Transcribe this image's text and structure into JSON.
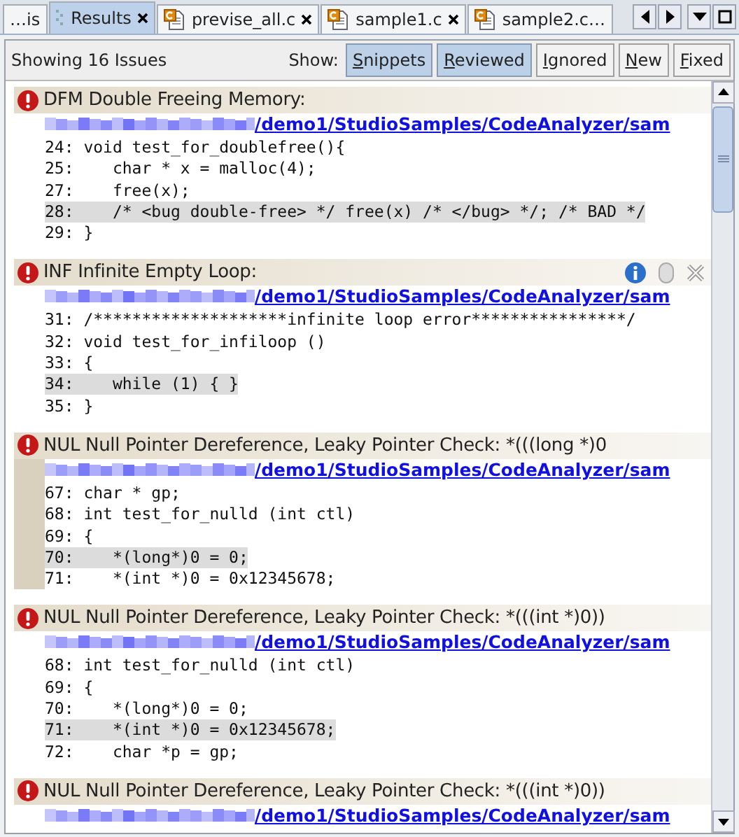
{
  "tabs": [
    {
      "label": "…is",
      "kind": "view",
      "selected": false,
      "closable": false
    },
    {
      "label": "Results",
      "kind": "view",
      "selected": true,
      "closable": true
    },
    {
      "label": "previse_all.c",
      "kind": "file",
      "selected": false,
      "closable": true
    },
    {
      "label": "sample1.c",
      "kind": "file",
      "selected": false,
      "closable": true
    },
    {
      "label": "sample2.c…",
      "kind": "file",
      "selected": false,
      "closable": false
    }
  ],
  "toolbar": {
    "summary": "Showing 16 Issues",
    "show_label": "Show:",
    "filters": [
      {
        "label": "Snippets",
        "selected": true
      },
      {
        "label": "Reviewed",
        "selected": true
      },
      {
        "label": "Ignored",
        "selected": false
      },
      {
        "label": "New",
        "selected": false
      },
      {
        "label": "Fixed",
        "selected": false
      }
    ]
  },
  "issues": [
    {
      "title": "DFM Double Freeing Memory:",
      "path": "/demo1/StudioSamples/CodeAnalyzer/sam",
      "selected": false,
      "hovered": false,
      "lines": [
        {
          "number": "24:",
          "code": "void test_for_doublefree(){",
          "highlighted": false
        },
        {
          "number": "25:",
          "code": "   char * x = malloc(4);",
          "highlighted": false
        },
        {
          "number": "27:",
          "code": "   free(x);",
          "highlighted": false
        },
        {
          "number": "28:",
          "code": "   /* <bug double-free> */ free(x) /* </bug> */; /* BAD */",
          "highlighted": true
        },
        {
          "number": "29:",
          "code": "}",
          "highlighted": false
        }
      ]
    },
    {
      "title": "INF Infinite Empty Loop:",
      "path": "/demo1/StudioSamples/CodeAnalyzer/sam",
      "selected": false,
      "hovered": true,
      "lines": [
        {
          "number": "31:",
          "code": "/********************infinite loop error****************/",
          "highlighted": false
        },
        {
          "number": "32:",
          "code": "void test_for_infiloop ()",
          "highlighted": false
        },
        {
          "number": "33:",
          "code": "{",
          "highlighted": false
        },
        {
          "number": "34:",
          "code": "   while (1) { }",
          "highlighted": true
        },
        {
          "number": "35:",
          "code": "}",
          "highlighted": false
        }
      ]
    },
    {
      "title": "NUL Null Pointer Dereference, Leaky Pointer Check: *(((long *)0",
      "path": "/demo1/StudioSamples/CodeAnalyzer/sam",
      "selected": true,
      "hovered": false,
      "lines": [
        {
          "number": "67:",
          "code": "char * gp;",
          "highlighted": false
        },
        {
          "number": "68:",
          "code": "int test_for_nulld (int ctl)",
          "highlighted": false
        },
        {
          "number": "69:",
          "code": "{",
          "highlighted": false
        },
        {
          "number": "70:",
          "code": "   *(long*)0 = 0;",
          "highlighted": true
        },
        {
          "number": "71:",
          "code": "   *(int *)0 = 0x12345678;",
          "highlighted": false
        }
      ]
    },
    {
      "title": "NUL Null Pointer Dereference, Leaky Pointer Check: *(((int *)0))",
      "path": "/demo1/StudioSamples/CodeAnalyzer/sam",
      "selected": false,
      "hovered": false,
      "lines": [
        {
          "number": "68:",
          "code": "int test_for_nulld (int ctl)",
          "highlighted": false
        },
        {
          "number": "69:",
          "code": "{",
          "highlighted": false
        },
        {
          "number": "70:",
          "code": "   *(long*)0 = 0;",
          "highlighted": false
        },
        {
          "number": "71:",
          "code": "   *(int *)0 = 0x12345678;",
          "highlighted": true
        },
        {
          "number": "72:",
          "code": "   char *p = gp;",
          "highlighted": false
        }
      ]
    },
    {
      "title": "NUL Null Pointer Dereference, Leaky Pointer Check: *(((int *)0))",
      "path": "/demo1/StudioSamples/CodeAnalyzer/sam",
      "selected": false,
      "hovered": false
    }
  ]
}
